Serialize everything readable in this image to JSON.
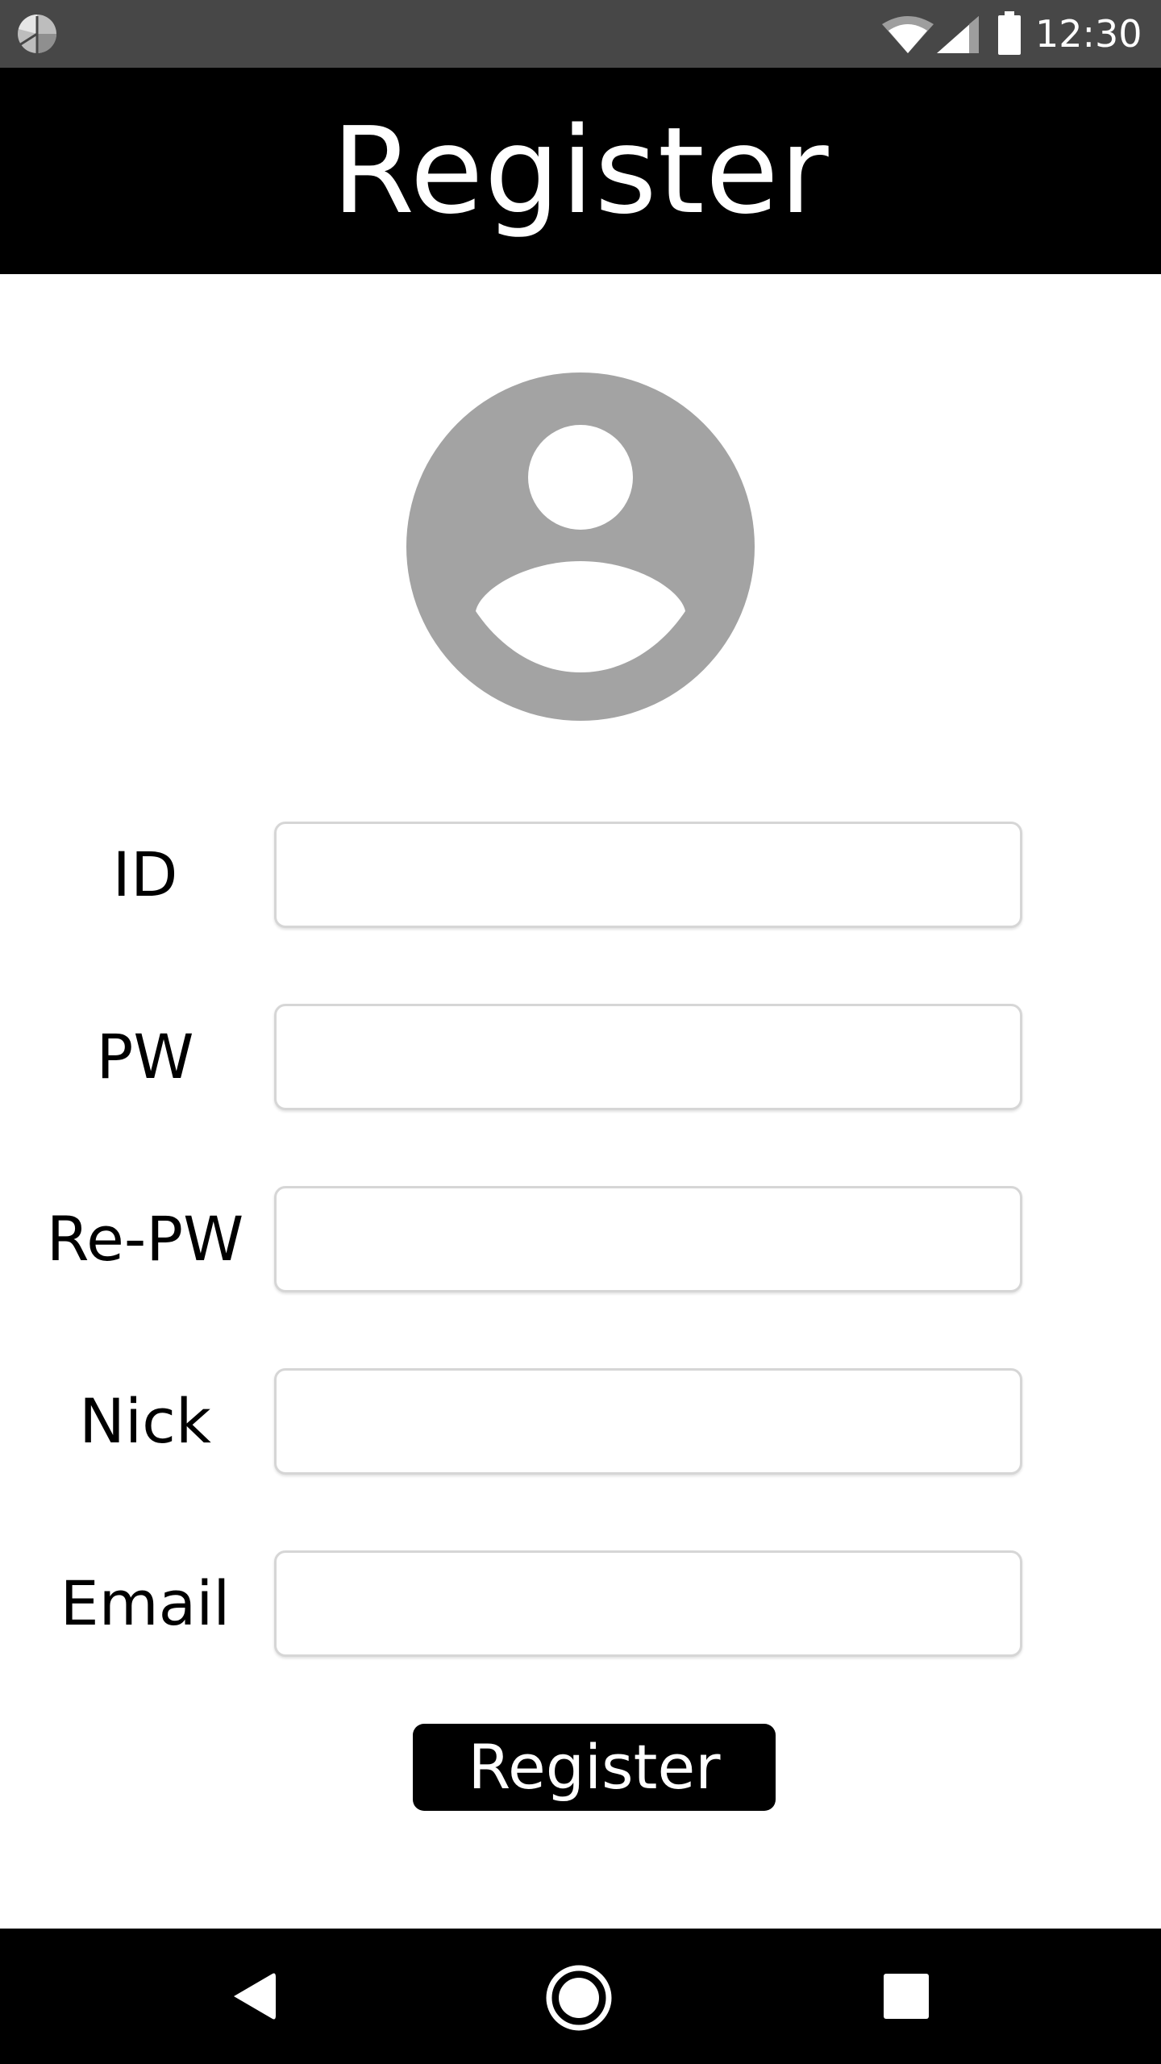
{
  "status_bar": {
    "time": "12:30",
    "icons": [
      "app-notification-icon",
      "wifi-icon",
      "cell-signal-icon",
      "battery-icon"
    ]
  },
  "app_bar": {
    "title": "Register"
  },
  "avatar": {
    "icon": "default-user-avatar-icon",
    "color": "#a3a3a3"
  },
  "form": {
    "fields": [
      {
        "label": "ID",
        "value": "",
        "placeholder": ""
      },
      {
        "label": "PW",
        "value": "",
        "placeholder": ""
      },
      {
        "label": "Re-PW",
        "value": "",
        "placeholder": ""
      },
      {
        "label": "Nick",
        "value": "",
        "placeholder": ""
      },
      {
        "label": "Email",
        "value": "",
        "placeholder": ""
      }
    ],
    "submit_label": "Register"
  },
  "nav_bar": {
    "icons": [
      "back-icon",
      "home-icon",
      "recents-icon"
    ]
  },
  "colors": {
    "status_bar": "#474747",
    "app_bar": "#000000",
    "button": "#000000",
    "input_border": "#d6d6d6"
  }
}
